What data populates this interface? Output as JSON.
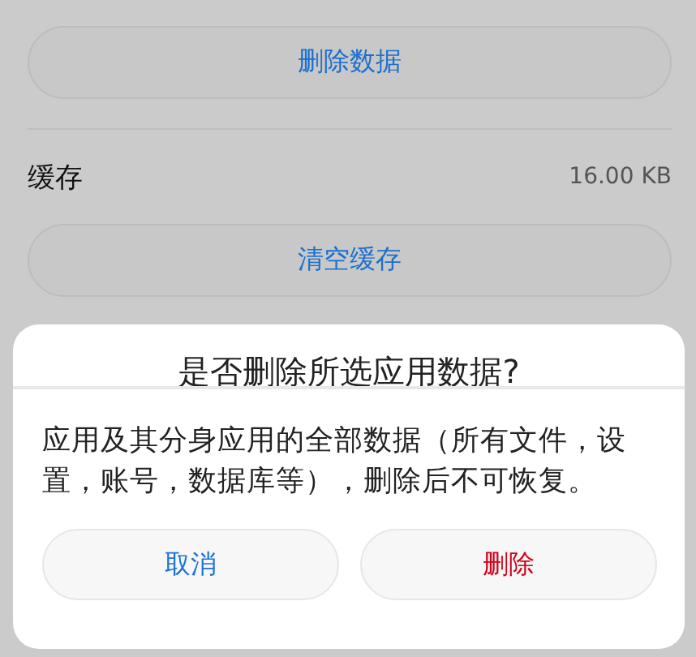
{
  "settings": {
    "delete_data_button": "删除数据",
    "cache": {
      "label": "缓存",
      "value": "16.00 KB"
    },
    "clear_cache_button": "清空缓存"
  },
  "dialog": {
    "title": "是否删除所选应用数据?",
    "message": "应用及其分身应用的全部数据（所有文件，设置，账号，数据库等），删除后不可恢复。",
    "buttons": [
      {
        "label": "取消",
        "kind": "normal"
      },
      {
        "label": "删除",
        "kind": "danger"
      }
    ]
  }
}
